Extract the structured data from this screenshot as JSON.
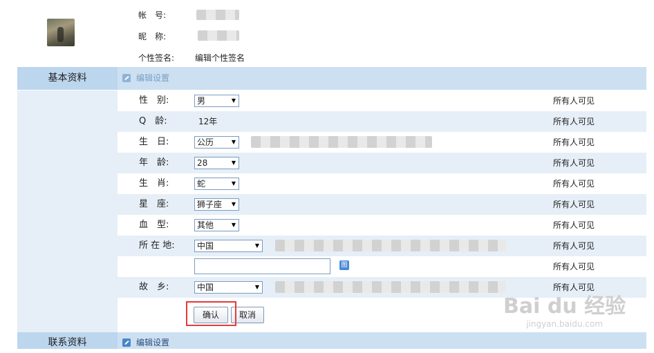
{
  "profile": {
    "account_label": "帐　号:",
    "nickname_label": "昵　称:",
    "signature_label": "个性签名:",
    "signature_value": "编辑个性签名"
  },
  "section_basic": {
    "title": "基本资料",
    "edit": "编辑设置"
  },
  "section_contact": {
    "title": "联系资料",
    "edit": "编辑设置"
  },
  "fields": [
    {
      "label": "性　别:",
      "value": "男",
      "visibility": "所有人可见"
    },
    {
      "label": "Q　龄:",
      "value": "12年",
      "visibility": "所有人可见"
    },
    {
      "label": "生　日:",
      "value": "公历",
      "visibility": "所有人可见"
    },
    {
      "label": "年　龄:",
      "value": "28",
      "visibility": "所有人可见"
    },
    {
      "label": "生　肖:",
      "value": "蛇",
      "visibility": "所有人可见"
    },
    {
      "label": "星　座:",
      "value": "狮子座",
      "visibility": "所有人可见"
    },
    {
      "label": "血　型:",
      "value": "其他",
      "visibility": "所有人可见"
    },
    {
      "label": "所 在 地:",
      "value": "中国",
      "visibility": "所有人可见"
    },
    {
      "label": "",
      "value": "",
      "visibility": "所有人可见"
    },
    {
      "label": "故　乡:",
      "value": "中国",
      "visibility": "所有人可见"
    }
  ],
  "buttons": {
    "confirm": "确认",
    "cancel": "取消"
  },
  "watermark": {
    "main": "Bai du 经验",
    "sub": "jingyan.baidu.com"
  }
}
